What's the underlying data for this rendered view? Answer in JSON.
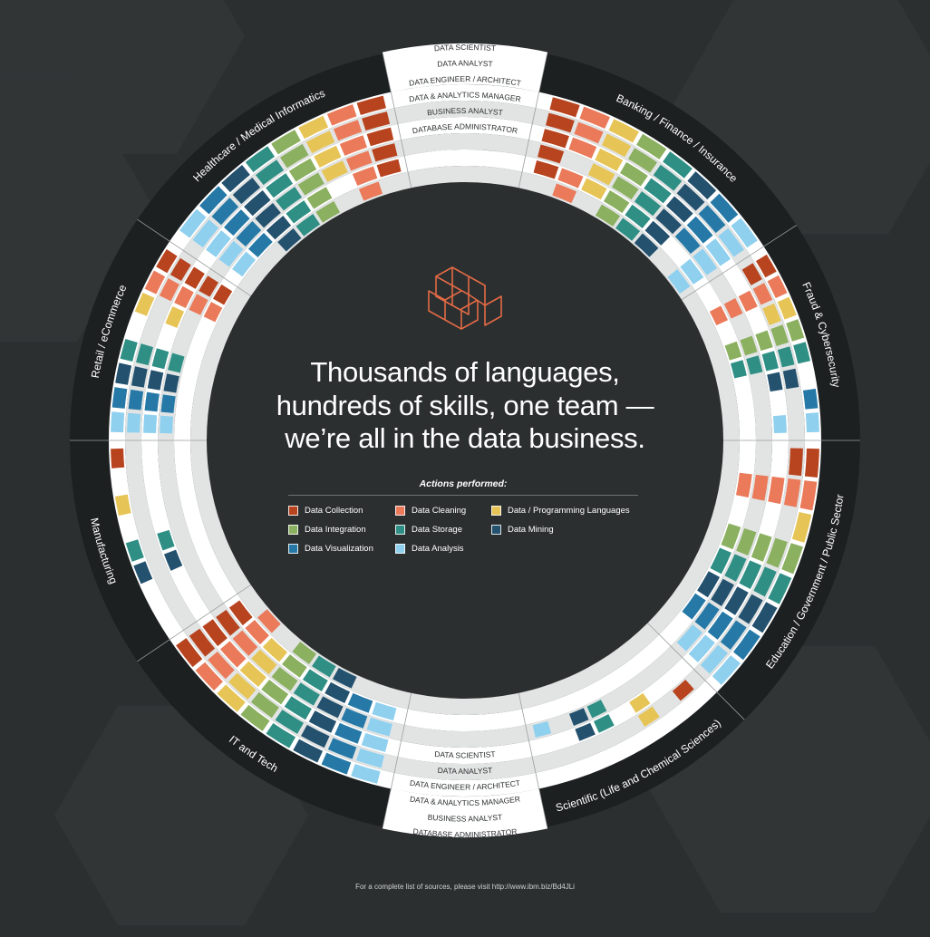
{
  "headline": {
    "line1": "Thousands of languages,",
    "line2": "hundreds of skills, one team —",
    "line3": "we’re all in the data business."
  },
  "legend": {
    "title": "Actions performed:",
    "items": [
      {
        "label": "Data Collection",
        "color": "#b8441f"
      },
      {
        "label": "Data Cleaning",
        "color": "#ea7a5a"
      },
      {
        "label": "Data / Programming Languages",
        "color": "#e6c456"
      },
      {
        "label": "Data Integration",
        "color": "#8bb060"
      },
      {
        "label": "Data Storage",
        "color": "#2f8f85"
      },
      {
        "label": "Data Mining",
        "color": "#24516e"
      },
      {
        "label": "Data Visualization",
        "color": "#2679a7"
      },
      {
        "label": "Data Analysis",
        "color": "#8fd0ef"
      }
    ]
  },
  "roles": [
    "DATA SCIENTIST",
    "DATA ANALYST",
    "DATA ENGINEER / ARCHITECT",
    "DATA & ANALYTICS MANAGER",
    "BUSINESS ANALYST",
    "DATABASE ADMINISTRATOR"
  ],
  "industries": [
    "Banking / Finance / Insurance",
    "Fraud & Cybersecurity",
    "Education / Government / Public Sector",
    "Scientific (Life and Chemical Sciences)",
    "IT and Tech",
    "Manufacturing",
    "Retail / eCommerce",
    "Healthcare / Medical Informatics"
  ],
  "industry_actions": [
    [
      [
        1,
        1,
        1,
        1,
        1,
        1,
        1,
        1
      ],
      [
        1,
        1,
        1,
        1,
        1,
        1,
        1,
        1
      ],
      [
        1,
        1,
        1,
        1,
        1,
        1,
        1,
        1
      ],
      [
        1,
        0,
        1,
        1,
        1,
        1,
        1,
        1
      ],
      [
        1,
        1,
        1,
        1,
        1,
        1,
        0,
        1
      ],
      [
        0,
        1,
        0,
        1,
        1,
        1,
        0,
        1
      ]
    ],
    [
      [
        1,
        1,
        1,
        1,
        1,
        0,
        1,
        1
      ],
      [
        1,
        1,
        1,
        1,
        1,
        1,
        0,
        0
      ],
      [
        0,
        1,
        0,
        1,
        1,
        1,
        0,
        1
      ],
      [
        0,
        1,
        0,
        1,
        1,
        0,
        0,
        0
      ],
      [
        0,
        1,
        0,
        1,
        1,
        0,
        0,
        0
      ],
      [
        0,
        0,
        0,
        0,
        0,
        0,
        0,
        0
      ]
    ],
    [
      [
        1,
        1,
        1,
        1,
        1,
        1,
        1,
        1
      ],
      [
        1,
        1,
        0,
        1,
        1,
        1,
        1,
        1
      ],
      [
        0,
        1,
        0,
        1,
        1,
        1,
        1,
        1
      ],
      [
        0,
        1,
        0,
        1,
        1,
        1,
        1,
        1
      ],
      [
        0,
        1,
        0,
        1,
        1,
        1,
        1,
        0
      ],
      [
        0,
        0,
        0,
        0,
        0,
        0,
        0,
        0
      ]
    ],
    [
      [
        0,
        0,
        0,
        0,
        0,
        0,
        0,
        0
      ],
      [
        1,
        0,
        1,
        0,
        0,
        0,
        0,
        0
      ],
      [
        0,
        0,
        1,
        0,
        1,
        1,
        0,
        0
      ],
      [
        0,
        0,
        0,
        0,
        1,
        1,
        0,
        1
      ],
      [
        0,
        0,
        0,
        0,
        0,
        0,
        0,
        0
      ],
      [
        0,
        0,
        0,
        0,
        0,
        0,
        0,
        0
      ]
    ],
    [
      [
        1,
        1,
        1,
        1,
        1,
        1,
        1,
        1
      ],
      [
        1,
        1,
        1,
        1,
        1,
        1,
        1,
        1
      ],
      [
        1,
        1,
        1,
        1,
        1,
        1,
        1,
        1
      ],
      [
        1,
        1,
        1,
        1,
        1,
        1,
        1,
        1
      ],
      [
        1,
        1,
        1,
        1,
        1,
        1,
        1,
        1
      ],
      [
        0,
        1,
        0,
        1,
        1,
        1,
        0,
        0
      ]
    ],
    [
      [
        1,
        0,
        1,
        0,
        1,
        1,
        0,
        0
      ],
      [
        0,
        0,
        0,
        0,
        0,
        0,
        0,
        0
      ],
      [
        0,
        0,
        0,
        0,
        1,
        1,
        0,
        0
      ],
      [
        0,
        0,
        0,
        0,
        0,
        0,
        0,
        0
      ],
      [
        0,
        0,
        0,
        0,
        0,
        0,
        0,
        0
      ],
      [
        0,
        0,
        0,
        0,
        0,
        0,
        0,
        0
      ]
    ],
    [
      [
        1,
        1,
        1,
        0,
        1,
        1,
        1,
        1
      ],
      [
        1,
        1,
        0,
        0,
        1,
        1,
        1,
        1
      ],
      [
        1,
        1,
        1,
        0,
        1,
        1,
        1,
        1
      ],
      [
        1,
        1,
        0,
        0,
        1,
        1,
        1,
        1
      ],
      [
        1,
        1,
        0,
        0,
        0,
        0,
        0,
        0
      ],
      [
        0,
        0,
        0,
        0,
        0,
        0,
        0,
        0
      ]
    ],
    [
      [
        1,
        1,
        1,
        1,
        1,
        1,
        1,
        1
      ],
      [
        1,
        1,
        1,
        1,
        1,
        1,
        1,
        1
      ],
      [
        1,
        1,
        1,
        1,
        1,
        1,
        1,
        1
      ],
      [
        1,
        1,
        1,
        1,
        1,
        1,
        1,
        1
      ],
      [
        1,
        1,
        0,
        1,
        1,
        1,
        1,
        1
      ],
      [
        0,
        1,
        0,
        1,
        1,
        1,
        0,
        0
      ]
    ]
  ],
  "footer": "For a complete list of sources, please visit http://www.ibm.biz/Bd4JLi",
  "colors": {
    "background": "#2c2f30",
    "industry_band": "#1d2021",
    "ring_white": "#ffffff",
    "ring_gray": "#e2e4e4",
    "logo": "#e26a45"
  }
}
